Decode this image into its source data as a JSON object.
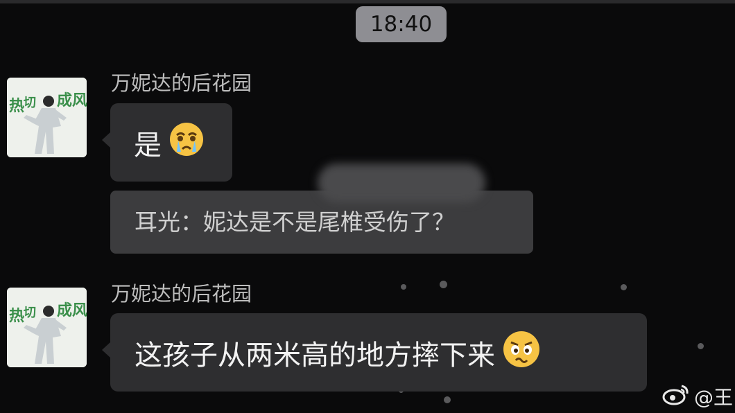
{
  "chat": {
    "time": "18:40",
    "messages": [
      {
        "sender": "万妮达的后花园",
        "text": "是",
        "emoji": "crying-face-icon"
      },
      {
        "quote": "耳光：妮达是不是尾椎受伤了？"
      },
      {
        "sender": "万妮达的后花园",
        "text": "这孩子从两米高的地方摔下来",
        "emoji": "worried-face-icon"
      }
    ]
  },
  "watermark": {
    "text": "@王",
    "icon": "weibo-logo-icon"
  },
  "colors": {
    "background": "#0a0a0b",
    "bubble": "#2e2e30",
    "quote_bubble": "#3c3c3e",
    "time_badge": "#8e8e93",
    "emoji": "#f6c344"
  }
}
